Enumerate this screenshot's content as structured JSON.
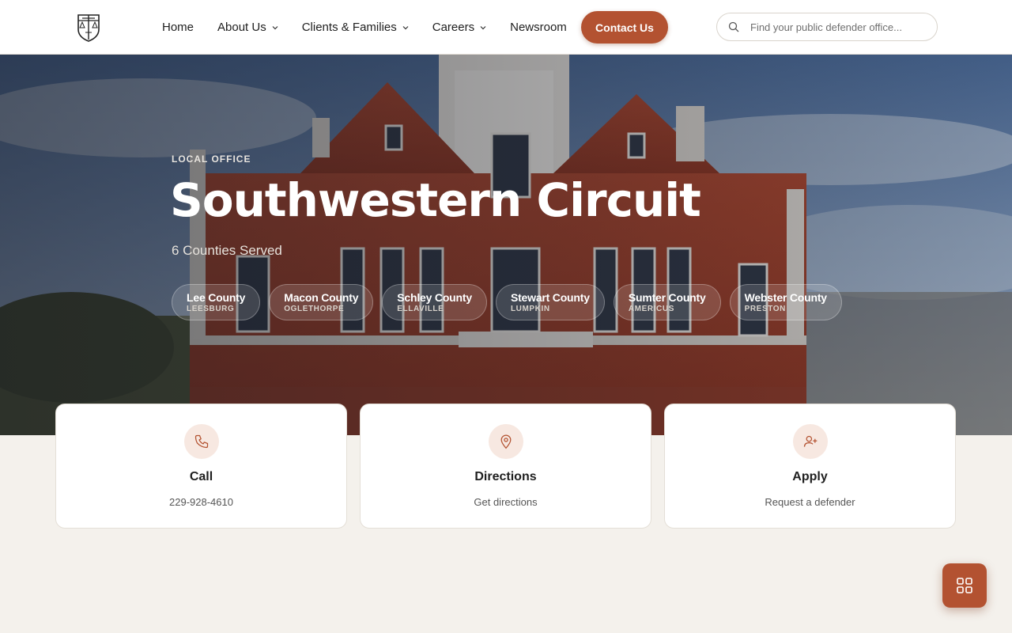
{
  "header": {
    "logo_icon": "scales-of-justice-shield-icon",
    "nav": [
      {
        "label": "Home",
        "has_dropdown": false
      },
      {
        "label": "About Us",
        "has_dropdown": true
      },
      {
        "label": "Clients & Families",
        "has_dropdown": true
      },
      {
        "label": "Careers",
        "has_dropdown": true
      },
      {
        "label": "Newsroom",
        "has_dropdown": false
      }
    ],
    "contact_label": "Contact Us",
    "search_placeholder": "Find your public defender office..."
  },
  "hero": {
    "eyebrow": "LOCAL OFFICE",
    "title": "Southwestern Circuit",
    "subtitle": "6 Counties Served",
    "counties": [
      {
        "name": "Lee County",
        "town": "LEESBURG"
      },
      {
        "name": "Macon County",
        "town": "OGLETHORPE"
      },
      {
        "name": "Schley County",
        "town": "ELLAVILLE"
      },
      {
        "name": "Stewart County",
        "town": "LUMPKIN"
      },
      {
        "name": "Sumter County",
        "town": "AMERICUS"
      },
      {
        "name": "Webster County",
        "town": "PRESTON"
      }
    ]
  },
  "cards": [
    {
      "icon": "phone-icon",
      "title": "Call",
      "subtitle": "229-928-4610"
    },
    {
      "icon": "map-pin-icon",
      "title": "Directions",
      "subtitle": "Get directions"
    },
    {
      "icon": "user-plus-icon",
      "title": "Apply",
      "subtitle": "Request a defender"
    }
  ],
  "fab_icon": "grid-icon",
  "colors": {
    "accent": "#b35231",
    "background": "#f4f1ec",
    "icon_bg": "#f7e8e1"
  }
}
